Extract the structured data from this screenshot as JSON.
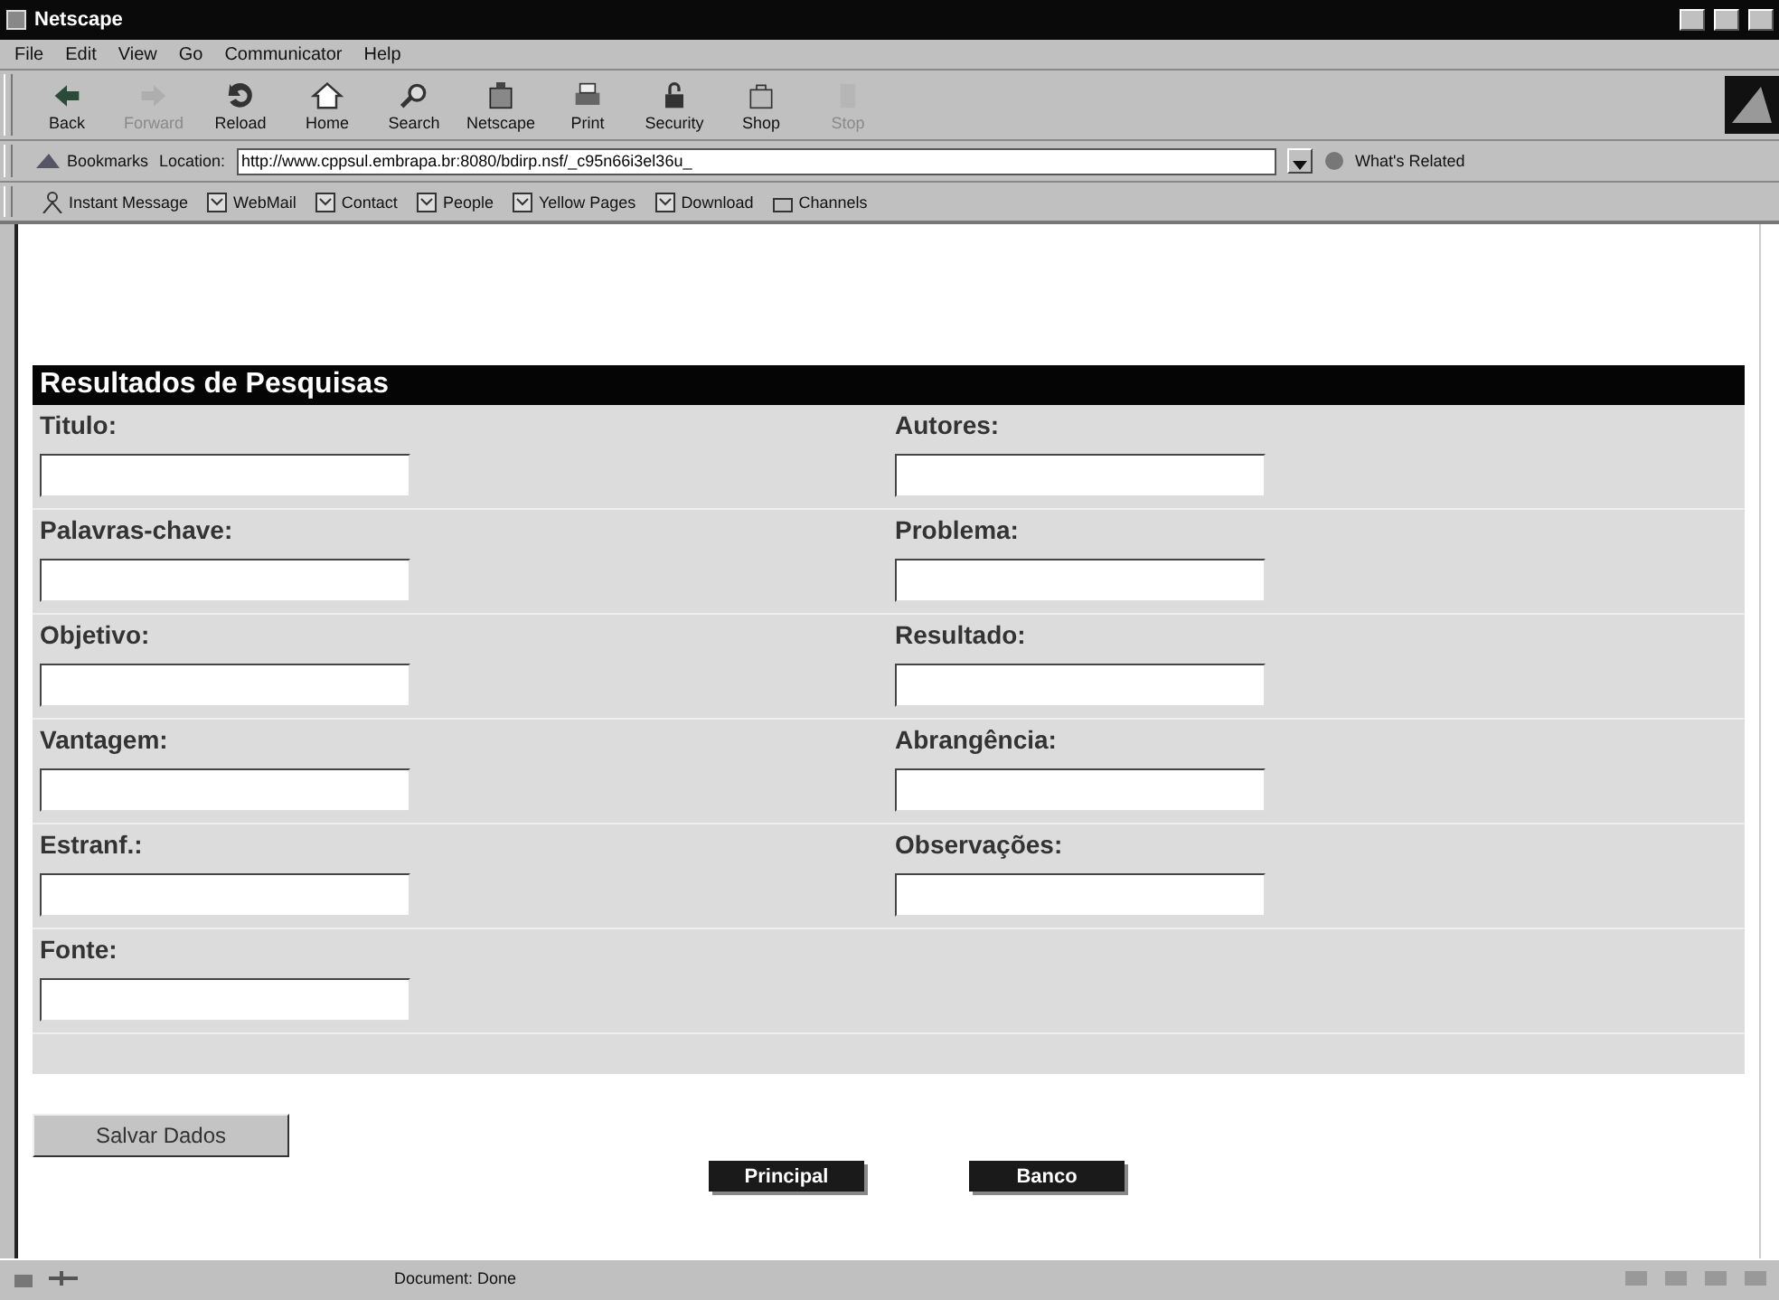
{
  "window": {
    "title": "Netscape"
  },
  "menu": [
    "File",
    "Edit",
    "View",
    "Go",
    "Communicator",
    "Help"
  ],
  "toolbar": [
    {
      "label": "Back",
      "disabled": false
    },
    {
      "label": "Forward",
      "disabled": true
    },
    {
      "label": "Reload",
      "disabled": false
    },
    {
      "label": "Home",
      "disabled": false
    },
    {
      "label": "Search",
      "disabled": false
    },
    {
      "label": "Netscape",
      "disabled": false
    },
    {
      "label": "Print",
      "disabled": false
    },
    {
      "label": "Security",
      "disabled": false
    },
    {
      "label": "Shop",
      "disabled": false
    },
    {
      "label": "Stop",
      "disabled": true
    }
  ],
  "location_bar": {
    "bookmarks": "Bookmarks",
    "location_label": "Location:",
    "url": "http://www.cppsul.embrapa.br:8080/bdirp.nsf/_c95n66i3el36u_",
    "related": "What's Related"
  },
  "personal_toolbar": [
    "Instant Message",
    "WebMail",
    "Contact",
    "People",
    "Yellow Pages",
    "Download",
    "Channels"
  ],
  "form": {
    "title": "Resultados de Pesquisas",
    "rows": [
      {
        "left": "Titulo:",
        "right": "Autores:"
      },
      {
        "left": "Palavras-chave:",
        "right": "Problema:"
      },
      {
        "left": "Objetivo:",
        "right": "Resultado:"
      },
      {
        "left": "Vantagem:",
        "right": "Abrangência:"
      },
      {
        "left": "Estranf.:",
        "right": "Observações:"
      },
      {
        "left": "Fonte:"
      }
    ],
    "save_button": "Salvar Dados",
    "nav_buttons": [
      "Principal",
      "Banco"
    ]
  },
  "status_bar": {
    "text": "Document: Done"
  }
}
